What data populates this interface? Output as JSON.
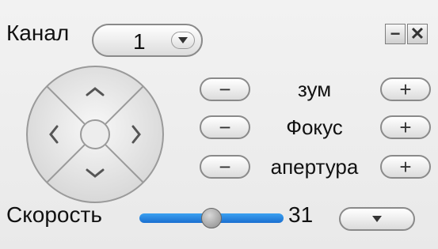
{
  "channel": {
    "label": "Канал",
    "value": "1"
  },
  "window_controls": {
    "minimize": "−",
    "close": "✕"
  },
  "ptz": {
    "up": "^",
    "down": "v",
    "left": "<",
    "right": ">"
  },
  "controls": [
    {
      "label": "зум",
      "minus": "−",
      "plus": "+"
    },
    {
      "label": "Фокус",
      "minus": "−",
      "plus": "+"
    },
    {
      "label": "апертура",
      "minus": "−",
      "plus": "+"
    }
  ],
  "speed": {
    "label": "Скорость",
    "value": "31",
    "level": 0.5
  }
}
